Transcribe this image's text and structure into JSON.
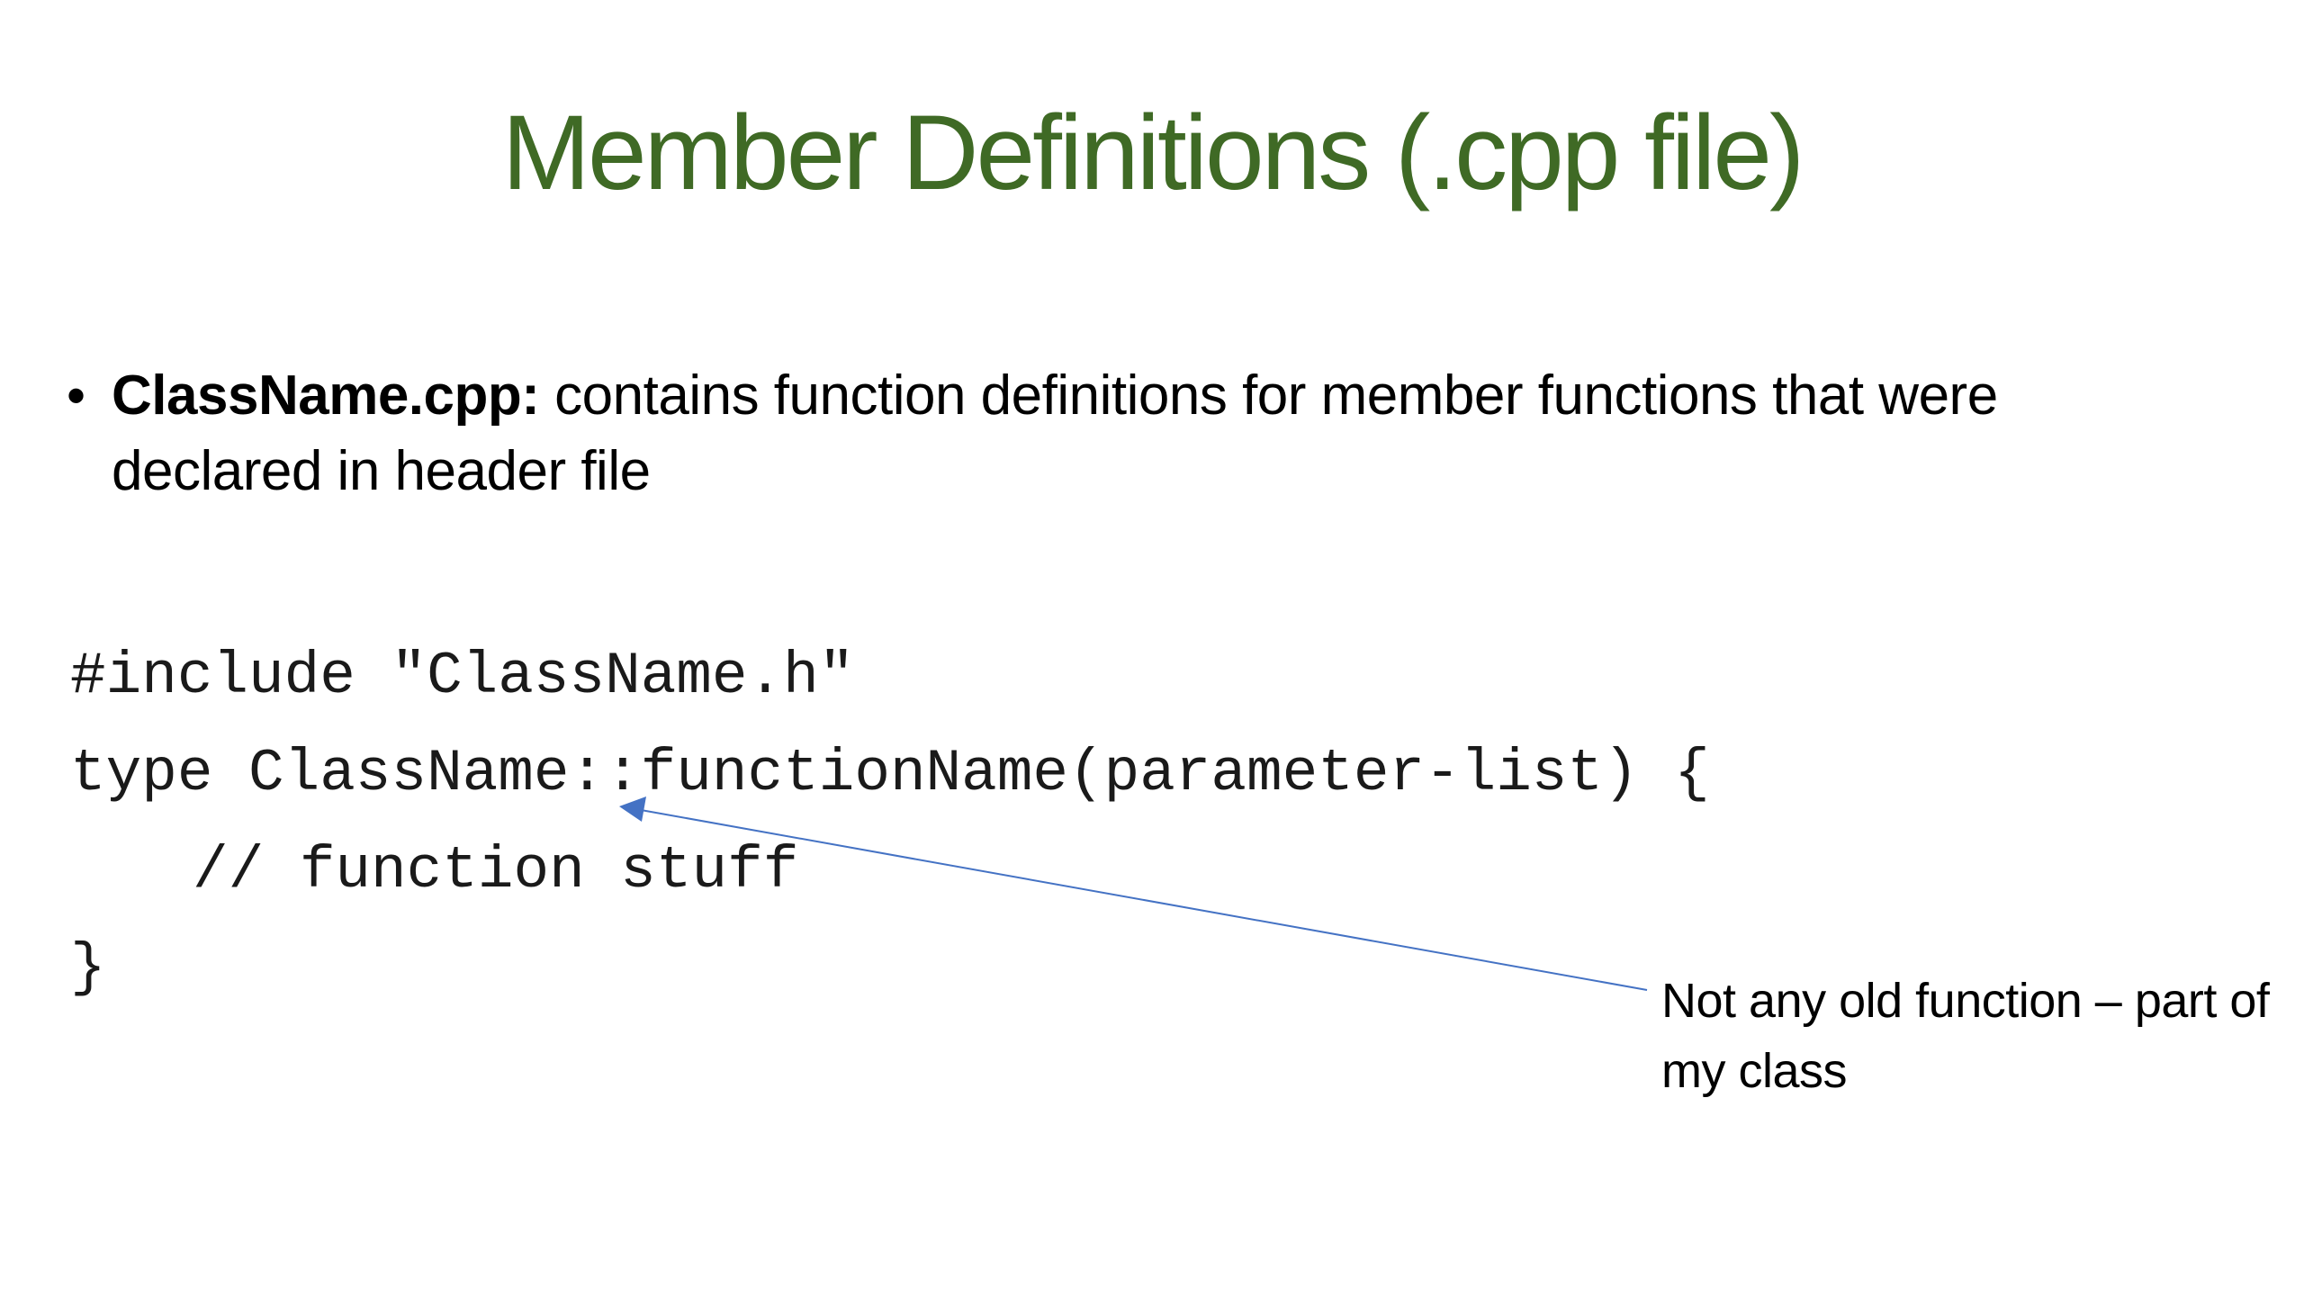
{
  "slide": {
    "title": "Member Definitions (.cpp file)",
    "bullet": {
      "marker": "•",
      "bold_lead": "ClassName.cpp:",
      "text": " contains function definitions for member functions that were declared in header file"
    },
    "code": {
      "line1": "#include \"ClassName.h\"",
      "line2": "type ClassName::functionName(parameter-list) {",
      "line3": "// function stuff",
      "line4": "}"
    },
    "annotation": {
      "text": "Not any old function – part of my class",
      "arrow_color": "#4472c4"
    },
    "colors": {
      "title": "#3f6a25",
      "background": "#ffffff",
      "text": "#000000"
    }
  }
}
